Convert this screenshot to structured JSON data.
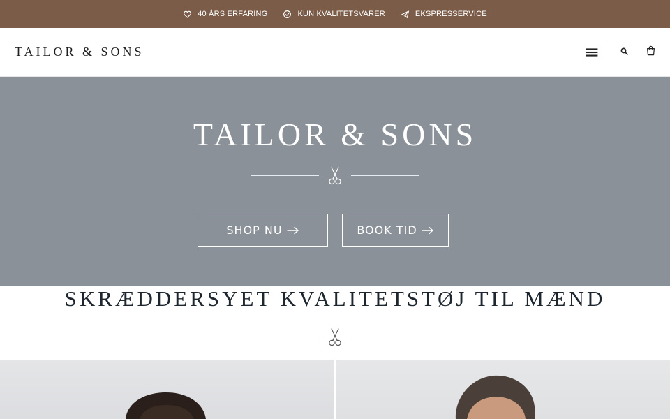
{
  "topbar": {
    "items": [
      {
        "label": "40 ÅRS ERFARING",
        "icon": "heart-icon"
      },
      {
        "label": "KUN KVALITETSVARER",
        "icon": "check-circle-icon"
      },
      {
        "label": "EKSPRESSERVICE",
        "icon": "paper-plane-icon"
      }
    ],
    "background": "#7a5c48"
  },
  "header": {
    "logo": "TAILOR & SONS",
    "icons": [
      "menu-icon",
      "search-icon",
      "cart-icon"
    ]
  },
  "hero": {
    "title": "TAILOR & SONS",
    "divider_icon": "scissors-icon",
    "buttons": [
      {
        "label": "SHOP NU",
        "icon": "arrow-right-icon"
      },
      {
        "label": "BOOK TID",
        "icon": "arrow-right-icon"
      }
    ],
    "background": "#8a9198"
  },
  "section": {
    "title": "SKRÆDDERSYET KVALITETSTØJ TIL MÆND",
    "divider_icon": "scissors-icon"
  },
  "photos": [
    {
      "name": "model-photo-left"
    },
    {
      "name": "model-photo-right"
    }
  ]
}
